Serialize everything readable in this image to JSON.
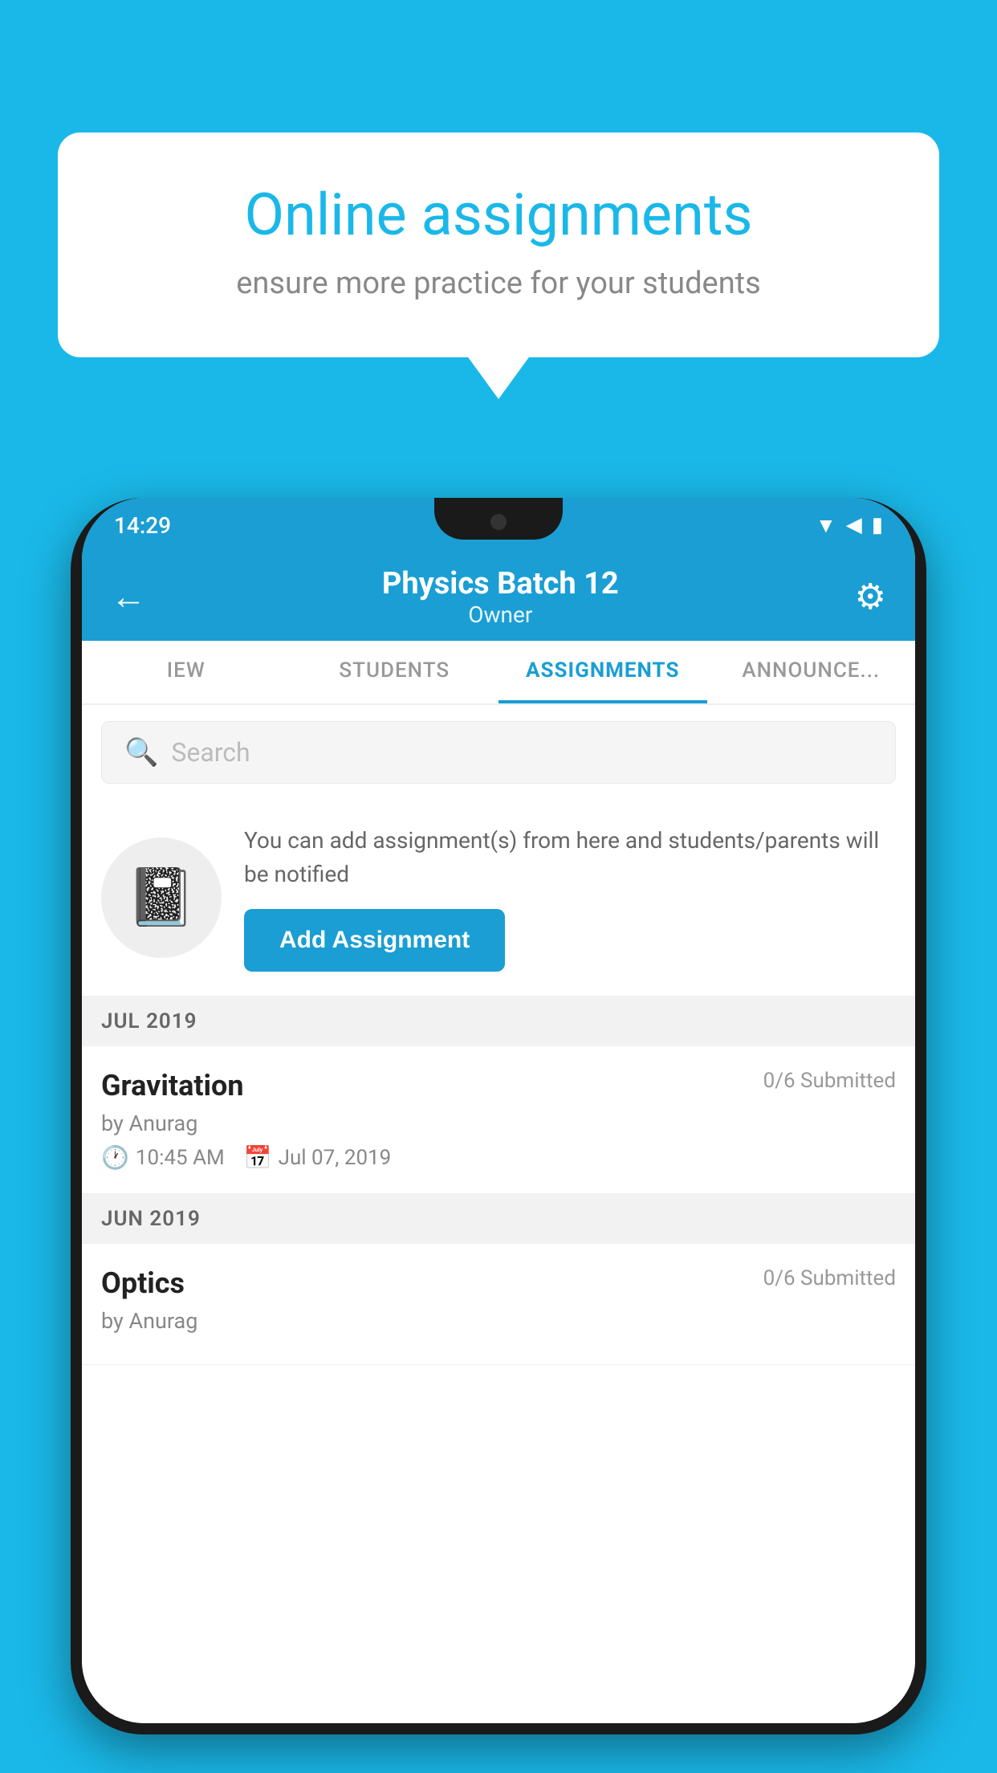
{
  "background_color": "#1ab8e8",
  "speech_bubble": {
    "title": "Online assignments",
    "subtitle": "ensure more practice for your students"
  },
  "phone": {
    "status_bar": {
      "time": "14:29",
      "icons": [
        "▼",
        "◀",
        "▮"
      ]
    },
    "header": {
      "title": "Physics Batch 12",
      "subtitle": "Owner",
      "back_label": "←",
      "gear_label": "⚙"
    },
    "tabs": [
      {
        "label": "IEW",
        "active": false
      },
      {
        "label": "STUDENTS",
        "active": false
      },
      {
        "label": "ASSIGNMENTS",
        "active": true
      },
      {
        "label": "ANNOUNCEMENTS",
        "active": false
      }
    ],
    "search": {
      "placeholder": "Search"
    },
    "promo": {
      "description": "You can add assignment(s) from here and students/parents will be notified",
      "button_label": "Add Assignment"
    },
    "sections": [
      {
        "month_label": "JUL 2019",
        "assignments": [
          {
            "name": "Gravitation",
            "submitted": "0/6 Submitted",
            "by": "by Anurag",
            "time": "10:45 AM",
            "date": "Jul 07, 2019"
          }
        ]
      },
      {
        "month_label": "JUN 2019",
        "assignments": [
          {
            "name": "Optics",
            "submitted": "0/6 Submitted",
            "by": "by Anurag",
            "time": "",
            "date": ""
          }
        ]
      }
    ]
  }
}
